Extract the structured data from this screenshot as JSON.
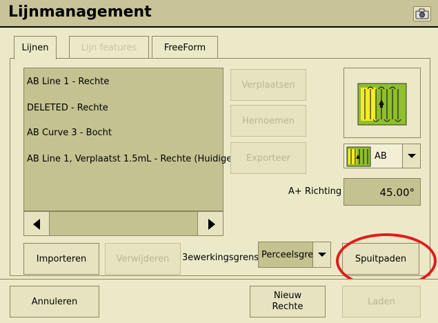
{
  "window": {
    "title": "Lijnmanagement",
    "camera_icon": "camera-icon"
  },
  "tabs": [
    {
      "label": "Lijnen",
      "state": "active"
    },
    {
      "label": "Lijn features",
      "state": "disabled"
    },
    {
      "label": "FreeForm",
      "state": "normal"
    }
  ],
  "lines": [
    "AB Line 1 - Rechte",
    "DELETED - Rechte",
    "AB Curve 3 - Bocht",
    "AB Line 1, Verplaatst 1.5mL - Rechte (Huidige"
  ],
  "actions": {
    "move": "Verplaatsen",
    "rename": "Hernoemen",
    "export": "Exporteer",
    "import": "Importeren",
    "delete": "Verwijderen",
    "spray_paths": "Spuitpaden"
  },
  "pattern": {
    "selected": "AB"
  },
  "direction": {
    "label": "A+ Richting",
    "value": "45.00°"
  },
  "boundary": {
    "label": "3ewerkingsgrens",
    "selected": "Perceelsgrer"
  },
  "footer": {
    "cancel": "Annuleren",
    "new_line_1": "Nieuw",
    "new_line_2": "Rechte",
    "load": "Laden"
  },
  "colors": {
    "highlight": "#e51919",
    "list_bg": "#c4c290",
    "title_bg": "#c8c399"
  }
}
